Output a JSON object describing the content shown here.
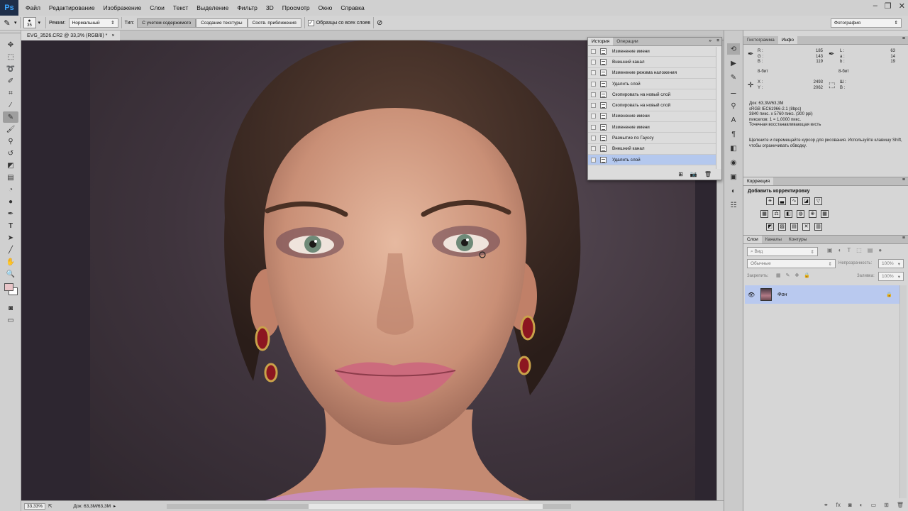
{
  "app": {
    "logo": "Ps"
  },
  "menu": [
    "Файл",
    "Редактирование",
    "Изображение",
    "Слои",
    "Текст",
    "Выделение",
    "Фильтр",
    "3D",
    "Просмотр",
    "Окно",
    "Справка"
  ],
  "window_controls": [
    "–",
    "❐",
    "✕"
  ],
  "options_bar": {
    "brush_size": "35",
    "mode_label": "Режим:",
    "mode_value": "Нормальный",
    "type_label": "Тип:",
    "type_options": [
      "С учетом содержимого",
      "Создание текстуры",
      "Соотв. приближения"
    ],
    "type_selected": 0,
    "sample_all_label": "Образцы со всех слоев",
    "sample_all_checked": true,
    "workspace": "Фотография"
  },
  "document": {
    "tab_title": "EVG_3526.CR2 @ 33,3% (RGB/8) *",
    "close": "×"
  },
  "status": {
    "zoom": "33,33%",
    "doc_info": "Док: 63,3M/63,3M"
  },
  "history_panel": {
    "tabs": [
      "История",
      "Операции"
    ],
    "items": [
      "Изменение имени",
      "Внешний канал",
      "Изменение режима наложения",
      "Удалить слой",
      "Скопировать на новый слой",
      "Скопировать на новый слой",
      "Изменение имени",
      "Изменение имени",
      "Размытие по Гауссу",
      "Внешний канал",
      "Удалить слой"
    ],
    "selected_index": 10
  },
  "info_panel": {
    "tabs": [
      "Гистограмма",
      "Инфо"
    ],
    "rgb_labels": [
      "R :",
      "G :",
      "B :"
    ],
    "rgb_values": [
      "185",
      "143",
      "119"
    ],
    "lab_labels": [
      "L :",
      "a :",
      "b :"
    ],
    "lab_values": [
      "63",
      "14",
      "19"
    ],
    "bits_left": "8-бит",
    "bits_right": "8-бит",
    "xy_labels": [
      "X :",
      "Y :"
    ],
    "xy_values": [
      "2493",
      "2062"
    ],
    "wh_labels": [
      "Ш :",
      "В :"
    ],
    "doc_lines": [
      "Док: 63,3M/63,3M",
      "sRGB IEC61966-2.1 (8bpc)",
      "3840 пикс. x 5760 пикс. (300 ppi)",
      "пикселов: 1 = 1,0000 пикс.",
      "Точечная восстанавливающая кисть"
    ],
    "hint": "Щелкните и перемещайте курсор для рисования. Используйте клавишу Shift, чтобы ограничивать обводку."
  },
  "correction_panel": {
    "tab": "Коррекция",
    "title": "Добавить корректировку"
  },
  "layers_panel": {
    "tabs": [
      "Слои",
      "Каналы",
      "Контуры"
    ],
    "filter_label": "Вид",
    "blend_mode": "Обычные",
    "opacity_label": "Непрозрачность:",
    "opacity_value": "100%",
    "lock_label": "Закрепить:",
    "fill_label": "Заливка:",
    "fill_value": "100%",
    "layers": [
      {
        "name": "Фон",
        "visible": true,
        "locked": true
      }
    ]
  },
  "colors": {
    "foreground": "#e9c5c8",
    "background": "#ffffff",
    "selection": "#b4c8ee"
  }
}
